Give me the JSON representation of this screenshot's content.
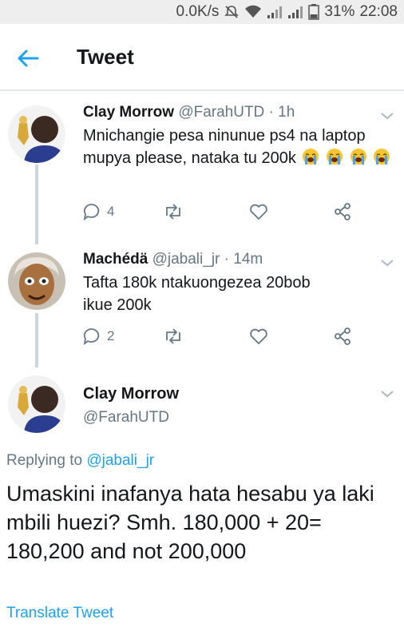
{
  "status_bar": {
    "speed": "0.0K/s",
    "battery": "31%",
    "time": "22:08",
    "icons": [
      "mute-icon",
      "wifi-icon",
      "signal-icon",
      "signal-icon",
      "battery-icon"
    ]
  },
  "header": {
    "title": "Tweet"
  },
  "thread": [
    {
      "name": "Clay Morrow",
      "handle_time": "@FarahUTD · 1h",
      "text": "Mnichangie pesa ninunue ps4 na laptop mupya please, nataka tu 200k",
      "emoji": "loudly-crying-face",
      "replies": "4"
    },
    {
      "name": "Machédä",
      "handle_time": "@jabali_jr · 14m",
      "text": "Tafta 180k ntakuongezea 20bob ikue 200k",
      "replies": "2"
    }
  ],
  "main_tweet": {
    "name": "Clay Morrow",
    "handle": "@FarahUTD",
    "replying_prefix": "Replying to ",
    "replying_to": "@jabali_jr",
    "text": "Umaskini inafanya hata hesabu ya laki mbili huezi? Smh. 180,000 + 20= 180,200 and not 200,000",
    "translate": "Translate Tweet"
  },
  "colors": {
    "accent": "#1da1f2",
    "muted": "#657786",
    "divider": "#e1e8ed"
  }
}
